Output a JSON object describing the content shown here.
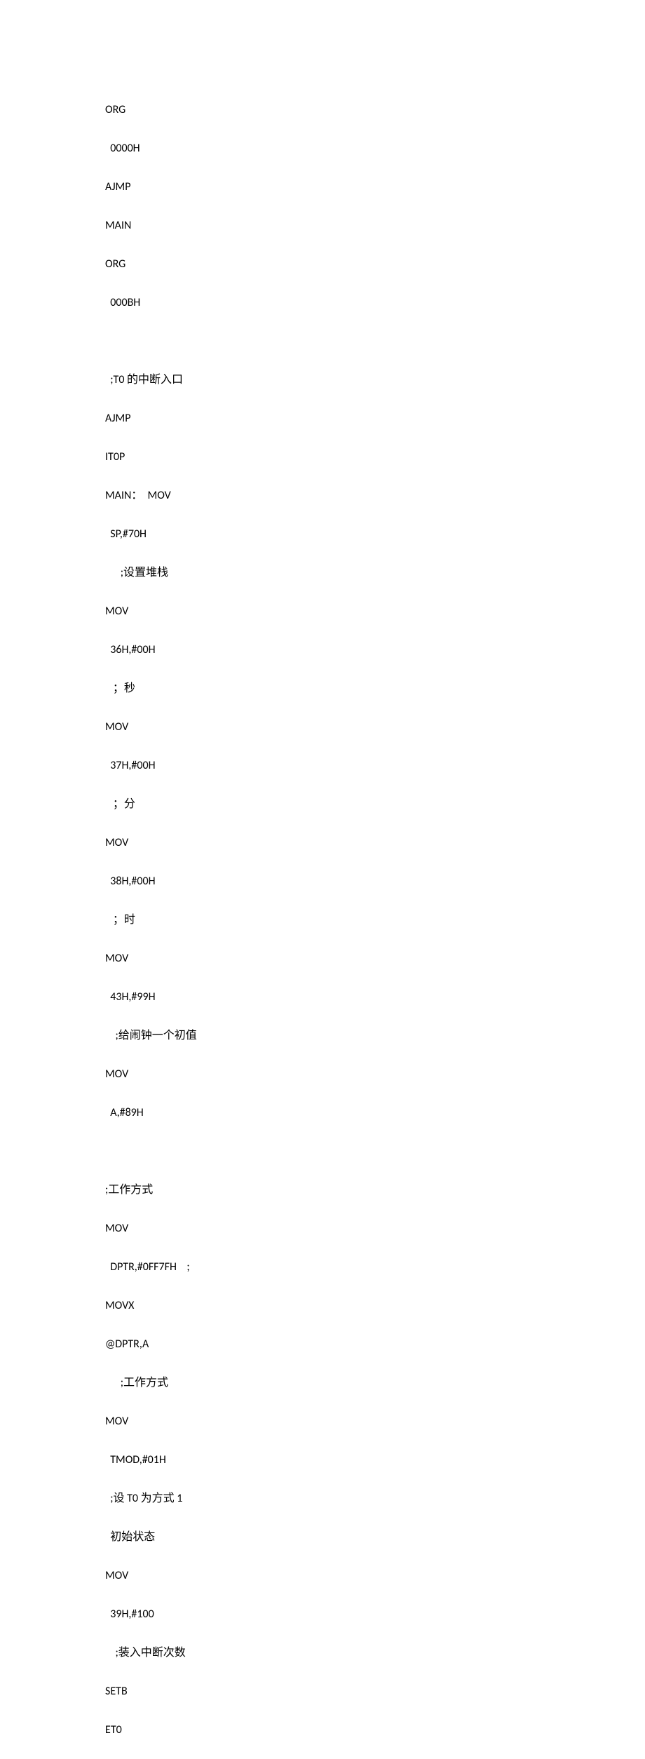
{
  "lines": [
    "ORG",
    "  0000H",
    "AJMP",
    "MAIN",
    "ORG",
    "  000BH",
    "",
    "  ;T0 的中断入口",
    "AJMP",
    "IT0P",
    "MAIN：  MOV",
    "  SP,#70H",
    "      ;设置堆栈",
    "MOV",
    "  36H,#00H",
    "   ；秒",
    "MOV",
    "  37H,#00H",
    "   ；分",
    "MOV",
    "  38H,#00H",
    "   ；时",
    "MOV",
    "  43H,#99H",
    "    ;给闹钟一个初值",
    "MOV",
    "  A,#89H",
    "",
    ";工作方式",
    "MOV",
    "  DPTR,#0FF7FH    ;",
    "MOVX",
    "@DPTR,A",
    "      ;工作方式",
    "MOV",
    "  TMOD,#01H",
    "  ;设 T0 为方式 1",
    "  初始状态",
    "MOV",
    "  39H,#100",
    "    ;装入中断次数",
    "SETB",
    "ET0"
  ]
}
